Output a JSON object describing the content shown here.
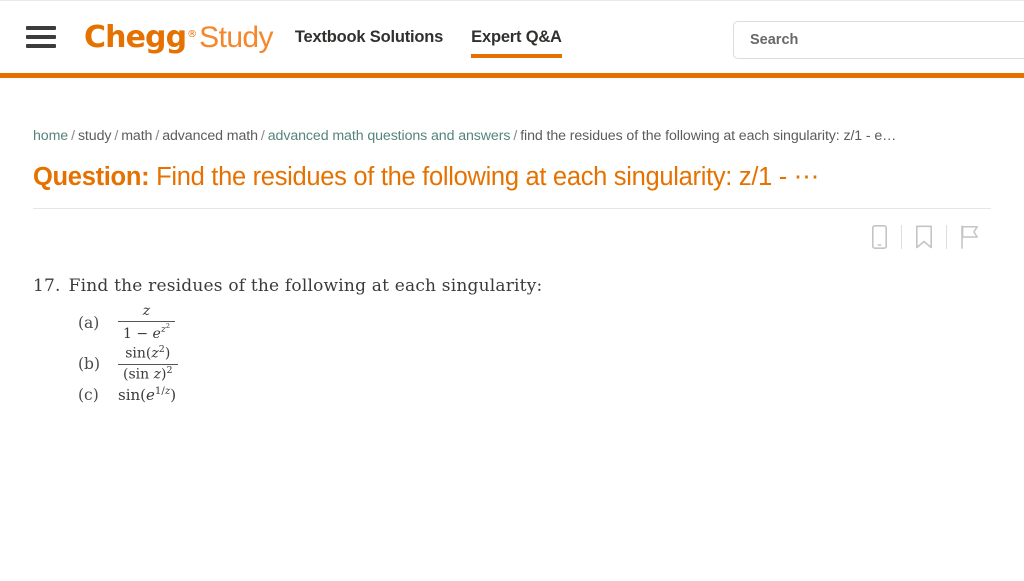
{
  "header": {
    "menu_icon": "hamburger-menu-icon",
    "logo": {
      "brand": "Chegg",
      "registered": "®",
      "product": "Study"
    },
    "nav": [
      {
        "label": "Textbook Solutions",
        "active": false
      },
      {
        "label": "Expert Q&A",
        "active": true
      }
    ],
    "search": {
      "placeholder": "Search",
      "value": ""
    },
    "accent_color": "#e57200"
  },
  "breadcrumb": {
    "separator": "/",
    "items": [
      {
        "label": "home",
        "type": "link"
      },
      {
        "label": "study",
        "type": "plain"
      },
      {
        "label": "math",
        "type": "plain"
      },
      {
        "label": "advanced math",
        "type": "plain"
      },
      {
        "label": "advanced math questions and answers",
        "type": "link"
      },
      {
        "label": "find the residues of the following at each singularity: z/1 - e…",
        "type": "current"
      }
    ]
  },
  "question": {
    "label": "Question:",
    "text": "Find the residues of the following at each singularity: z/1 - ⋯"
  },
  "actions": [
    {
      "name": "mobile-icon",
      "title": "Open in app"
    },
    {
      "name": "bookmark-icon",
      "title": "Bookmark"
    },
    {
      "name": "flag-icon",
      "title": "Report"
    }
  ],
  "problem": {
    "number": "17.",
    "prompt": "Find the residues of the following at each singularity:",
    "parts": [
      {
        "label": "(a)",
        "form": "fraction",
        "numerator": "z",
        "denominator": "1 − e^{z^2}",
        "plain": "z / (1 - e^{z^2})"
      },
      {
        "label": "(b)",
        "form": "fraction",
        "numerator": "sin(z^2)",
        "denominator": "(sin z)^2",
        "plain": "sin(z^2) / (sin z)^2"
      },
      {
        "label": "(c)",
        "form": "inline",
        "expression": "sin(e^{1/z})",
        "plain": "sin(e^{1/z})"
      }
    ]
  }
}
